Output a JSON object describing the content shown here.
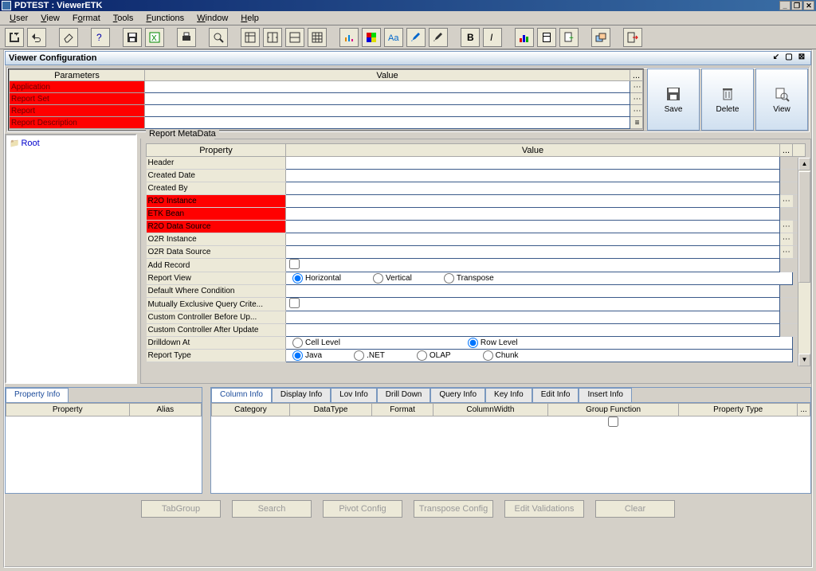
{
  "window": {
    "title": "PDTEST : ViewerETK"
  },
  "menu": {
    "user": "User",
    "view": "View",
    "format": "Format",
    "tools": "Tools",
    "functions": "Functions",
    "window": "Window",
    "help": "Help"
  },
  "panel": {
    "title": "Viewer Configuration"
  },
  "params": {
    "header_param": "Parameters",
    "header_value": "Value",
    "rows": [
      "Application",
      "Report Set",
      "Report",
      "Report Description"
    ]
  },
  "buttons": {
    "save": "Save",
    "delete": "Delete",
    "view": "View"
  },
  "tree": {
    "root": "Root"
  },
  "metadata": {
    "legend": "Report MetaData",
    "header_prop": "Property",
    "header_value": "Value",
    "header_dots": "...",
    "rows": {
      "header": "Header",
      "created_date": "Created Date",
      "created_by": "Created By",
      "r2o_instance": "R2O Instance",
      "etk_bean": "ETK Bean",
      "r2o_datasource": "R2O Data Source",
      "o2r_instance": "O2R Instance",
      "o2r_datasource": "O2R Data Source",
      "add_record": "Add Record",
      "report_view": "Report View",
      "default_where": "Default Where Condition",
      "mutually_excl": "Mutually Exclusive Query Crite...",
      "custom_before": "Custom Controller Before Up...",
      "custom_after": "Custom Controller After Update",
      "drilldown_at": "Drilldown At",
      "report_type": "Report Type"
    },
    "report_view_opts": {
      "h": "Horizontal",
      "v": "Vertical",
      "t": "Transpose"
    },
    "drilldown_opts": {
      "cell": "Cell Level",
      "row": "Row Level"
    },
    "report_type_opts": {
      "java": "Java",
      "net": ".NET",
      "olap": "OLAP",
      "chunk": "Chunk"
    }
  },
  "left_tabs": {
    "property_info": "Property Info",
    "cols": {
      "property": "Property",
      "alias": "Alias"
    }
  },
  "right_tabs": {
    "column_info": "Column Info",
    "display_info": "Display Info",
    "lov_info": "Lov Info",
    "drill_down": "Drill Down",
    "query_info": "Query Info",
    "key_info": "Key Info",
    "edit_info": "Edit Info",
    "insert_info": "Insert Info",
    "cols": {
      "category": "Category",
      "datatype": "DataType",
      "format": "Format",
      "colwidth": "ColumnWidth",
      "groupfn": "Group Function",
      "proptype": "Property Type",
      "dots": "..."
    }
  },
  "footer": {
    "tabgroup": "TabGroup",
    "search": "Search",
    "pivot": "Pivot Config",
    "transpose": "Transpose Config",
    "editval": "Edit Validations",
    "clear": "Clear"
  }
}
